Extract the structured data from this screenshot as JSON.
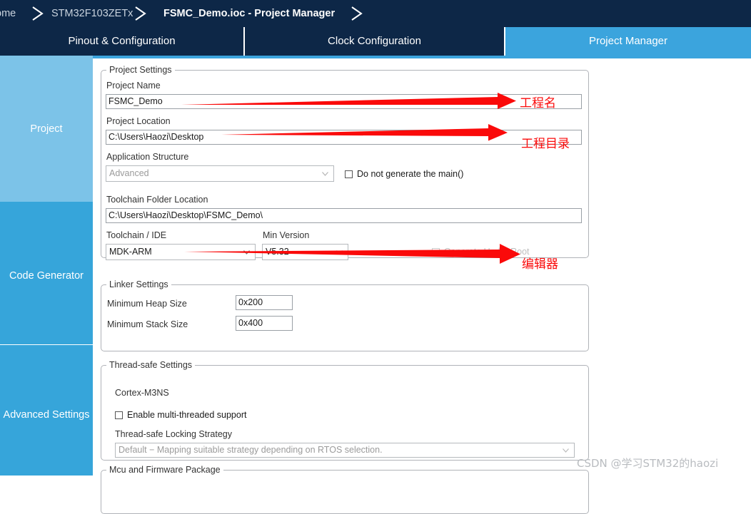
{
  "breadcrumb": {
    "items": [
      {
        "label": "ome",
        "active": false
      },
      {
        "label": "STM32F103ZETx",
        "active": false
      },
      {
        "label": "FSMC_Demo.ioc - Project Manager",
        "active": true
      }
    ]
  },
  "tabs": [
    {
      "label": "Pinout & Configuration",
      "active": false
    },
    {
      "label": "Clock Configuration",
      "active": false
    },
    {
      "label": "Project Manager",
      "active": true
    }
  ],
  "side_nav": {
    "items": [
      {
        "label": "Project",
        "selected": true
      },
      {
        "label": "Code Generator",
        "selected": false
      },
      {
        "label": "Advanced Settings",
        "selected": false
      }
    ]
  },
  "project_settings": {
    "group_title": "Project Settings",
    "project_name_label": "Project Name",
    "project_name_value": "FSMC_Demo",
    "project_location_label": "Project Location",
    "project_location_value": "C:\\Users\\Haozi\\Desktop",
    "application_structure_label": "Application Structure",
    "application_structure_value": "Advanced",
    "do_not_generate_main_label": "Do not generate the main()",
    "toolchain_folder_label": "Toolchain Folder Location",
    "toolchain_folder_value": "C:\\Users\\Haozi\\Desktop\\FSMC_Demo\\",
    "toolchain_ide_label": "Toolchain / IDE",
    "toolchain_ide_value": "MDK-ARM",
    "min_version_label": "Min Version",
    "min_version_value": "V5.32",
    "generate_under_root_label": "Generate Under Root"
  },
  "linker_settings": {
    "group_title": "Linker Settings",
    "min_heap_label": "Minimum Heap Size",
    "min_heap_value": "0x200",
    "min_stack_label": "Minimum Stack Size",
    "min_stack_value": "0x400"
  },
  "thread_safe_settings": {
    "group_title": "Thread-safe Settings",
    "core_label": "Cortex-M3NS",
    "enable_multithread_label": "Enable multi-threaded support",
    "locking_strategy_label": "Thread-safe Locking Strategy",
    "locking_strategy_value": "Default  −  Mapping suitable strategy depending on RTOS selection."
  },
  "mcu_firmware": {
    "group_title": "Mcu and Firmware Package"
  },
  "annotations": [
    {
      "text": "工程名"
    },
    {
      "text": "工程目录"
    },
    {
      "text": "编辑器"
    }
  ],
  "watermark": {
    "text": "CSDN @学习STM32的haozi"
  },
  "colors": {
    "breadcrumb_bg": "#0d2747",
    "tab_inactive_bg": "#0d2747",
    "tab_active_bg": "#3ba4dd",
    "nav_selected_bg": "#7cc3e8",
    "nav_normal_bg": "#36a5da",
    "annotation_red": "#fa0a0a"
  }
}
